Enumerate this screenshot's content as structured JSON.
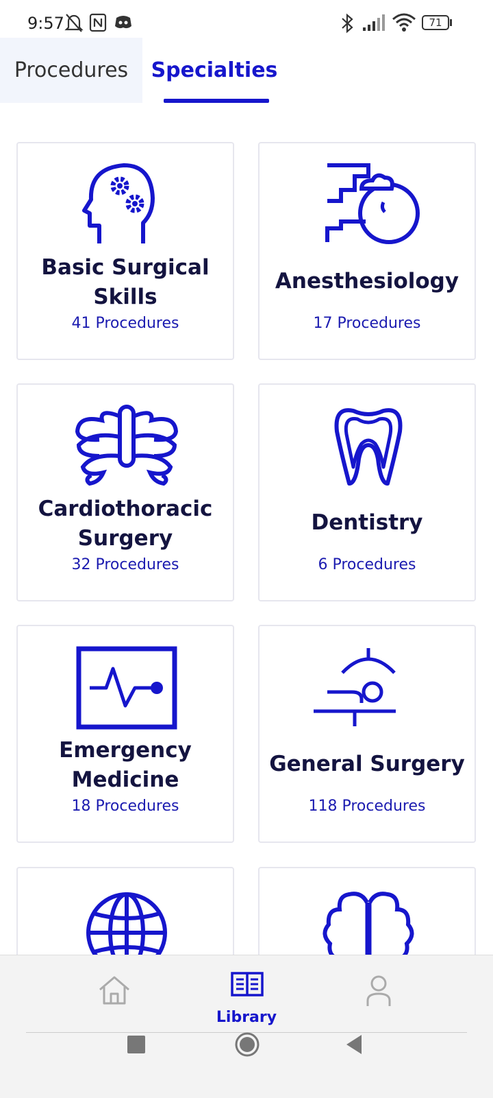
{
  "status_bar": {
    "time": "9:57",
    "battery": "71",
    "icons": [
      "mute-bell-icon",
      "nfc-icon",
      "discord-icon",
      "bluetooth-icon",
      "signal-icon",
      "wifi-icon",
      "battery-icon"
    ]
  },
  "tabs": [
    {
      "label": "Procedures",
      "active": false
    },
    {
      "label": "Specialties",
      "active": true
    }
  ],
  "colors": {
    "accent": "#1616cc",
    "title": "#141440",
    "tab_inactive_bg": "#f2f5fc"
  },
  "specialties": [
    {
      "name": "Basic Surgical Skills",
      "count": "41 Procedures",
      "icon": "head-gears-icon"
    },
    {
      "name": "Anesthesiology",
      "count": "17 Procedures",
      "icon": "anesthesia-mask-icon"
    },
    {
      "name": "Cardiothoracic Surgery",
      "count": "32 Procedures",
      "icon": "ribcage-icon"
    },
    {
      "name": "Dentistry",
      "count": "6 Procedures",
      "icon": "tooth-icon"
    },
    {
      "name": "Emergency Medicine",
      "count": "18 Procedures",
      "icon": "heart-monitor-icon"
    },
    {
      "name": "General Surgery",
      "count": "118 Procedures",
      "icon": "operating-table-icon"
    },
    {
      "name": "",
      "count": "",
      "icon": "globe-icon"
    },
    {
      "name": "",
      "count": "",
      "icon": "brain-icon"
    }
  ],
  "bottom_nav": [
    {
      "label": "",
      "icon": "home-icon",
      "active": false
    },
    {
      "label": "Library",
      "icon": "library-book-icon",
      "active": true
    },
    {
      "label": "",
      "icon": "profile-icon",
      "active": false
    }
  ],
  "system_nav": [
    "recents-square-icon",
    "home-circle-icon",
    "back-triangle-icon"
  ]
}
